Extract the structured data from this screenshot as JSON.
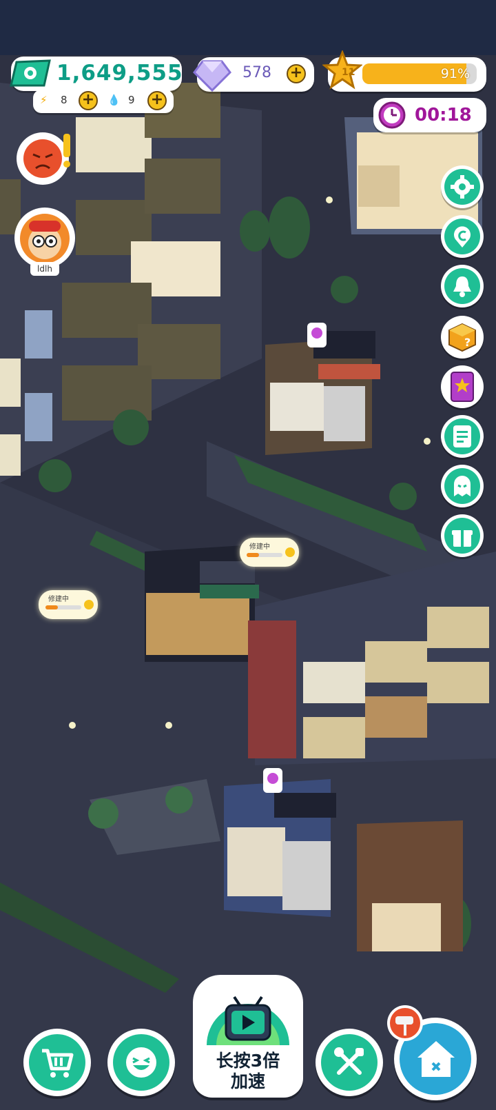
{
  "hud": {
    "money": "1,649,555",
    "energy": "8",
    "water": "9",
    "gems": "578",
    "level": "11",
    "level_progress_label": "91%",
    "level_progress": 0.91,
    "timer": "00:18"
  },
  "player": {
    "name": "ldlh"
  },
  "bubbles": [
    {
      "label": "修建中"
    },
    {
      "label": "修建中"
    }
  ],
  "side_menu": [
    {
      "icon": "gear-icon"
    },
    {
      "icon": "currency-c-icon"
    },
    {
      "icon": "bell-icon"
    },
    {
      "icon": "mystery-box-icon"
    },
    {
      "icon": "star-book-icon"
    },
    {
      "icon": "notes-icon"
    },
    {
      "icon": "ghost-icon"
    },
    {
      "icon": "gift-icon"
    }
  ],
  "bottom_bar": {
    "speed_label_line1": "长按3倍",
    "speed_label_line2": "加速",
    "icons": [
      "shop-cart-icon",
      "laugh-face-icon",
      "tv-play-icon",
      "tools-icon",
      "house-build-icon"
    ]
  },
  "colors": {
    "accent": "#1fbf95",
    "coin": "#f6c21c",
    "money_text": "#0d9d86",
    "timer_text": "#a0169a"
  }
}
